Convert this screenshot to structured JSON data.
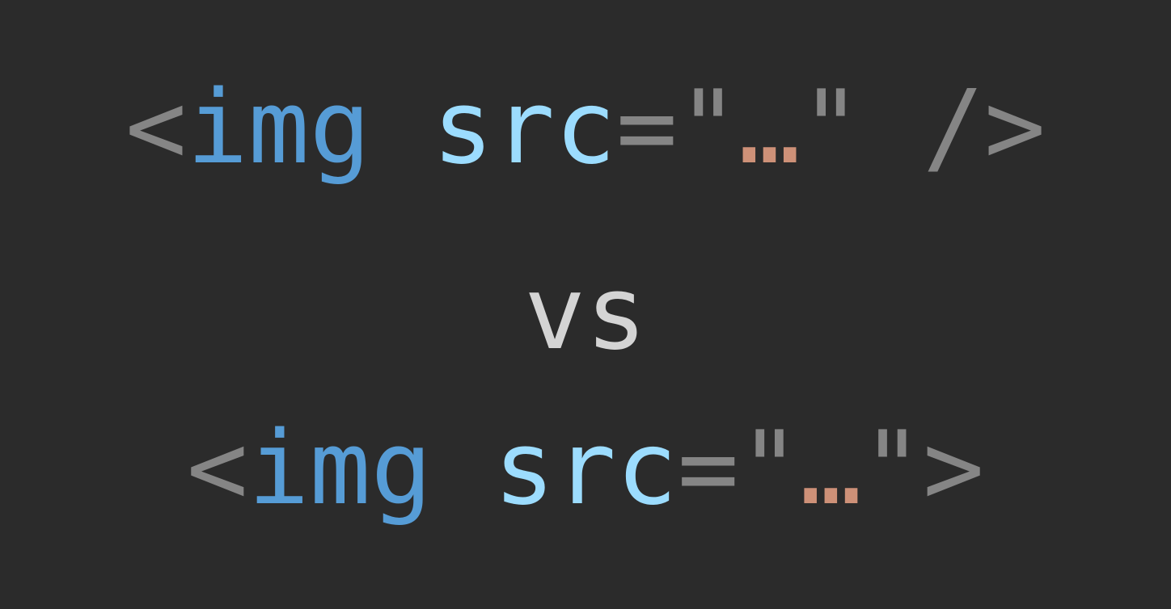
{
  "colors": {
    "background": "#2b2b2b",
    "punctuation": "#858585",
    "tag": "#569cd6",
    "attribute": "#9cdcfe",
    "value": "#ce9178",
    "separator": "#d4d4d4"
  },
  "line1": {
    "open": "<",
    "tag": "img",
    "space": " ",
    "attr": "src",
    "equals_quote": "=\"",
    "value": "…",
    "close": "\" />"
  },
  "separator": "vs",
  "line2": {
    "open": "<",
    "tag": "img",
    "space": " ",
    "attr": "src",
    "equals_quote": "=\"",
    "value": "…",
    "close": "\">"
  }
}
